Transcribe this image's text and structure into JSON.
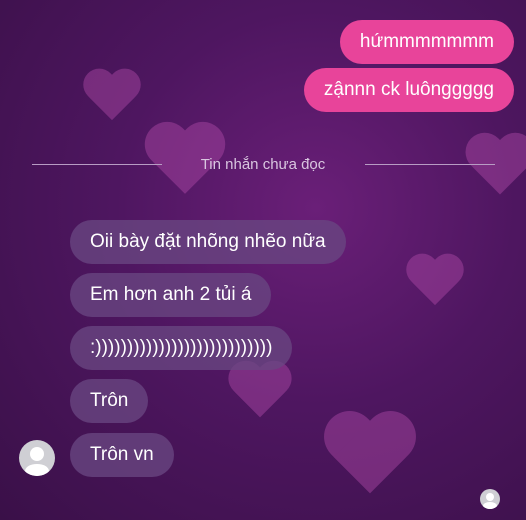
{
  "sent_messages": [
    "hứmmmmmmm",
    "zậnnn ck luônggggg"
  ],
  "divider": {
    "label": "Tin nhắn chưa đọc"
  },
  "received_messages": [
    "Oii bày đặt nhõng nhẽo nữa",
    "Em hơn anh 2 tủi á",
    ":))))))))))))))))))))))))))))",
    "Trôn",
    "Trôn vn"
  ],
  "colors": {
    "sent_bubble": "#e8449a",
    "received_bubble": "#694682",
    "background": "#4e1660"
  }
}
